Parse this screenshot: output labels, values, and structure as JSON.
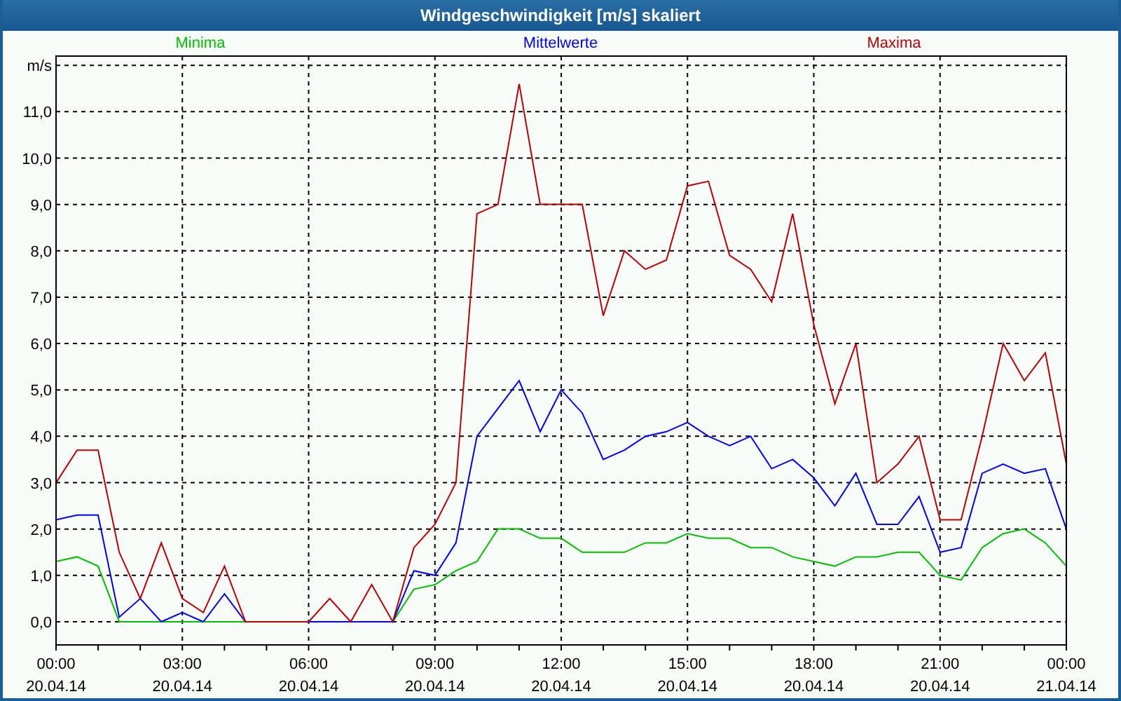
{
  "window": {
    "title": "Windgeschwindigkeit [m/s] skaliert"
  },
  "chart": {
    "chart_data": {
      "type": "line",
      "ylabel": "m/s",
      "grid": true,
      "categories": [
        "00:00 20.04.14",
        null,
        null,
        null,
        null,
        null,
        "03:00 20.04.14",
        null,
        null,
        null,
        null,
        null,
        "06:00 20.04.14",
        null,
        null,
        null,
        null,
        null,
        "09:00 20.04.14",
        null,
        null,
        null,
        null,
        null,
        "12:00 20.04.14",
        null,
        null,
        null,
        null,
        null,
        "15:00 20.04.14",
        null,
        null,
        null,
        null,
        null,
        "18:00 20.04.14",
        null,
        null,
        null,
        null,
        null,
        "21:00 20.04.14",
        null,
        null,
        null,
        null,
        null,
        "00:00 21.04.14"
      ],
      "series": [
        {
          "name": "Minima",
          "color": "#00c000",
          "values": [
            1.3,
            1.4,
            1.2,
            0,
            0,
            0,
            0,
            0,
            0,
            0,
            0,
            0,
            0,
            0,
            0,
            0,
            0,
            0.7,
            0.8,
            1.1,
            1.3,
            2.0,
            2.0,
            1.8,
            1.8,
            1.5,
            1.5,
            1.5,
            1.7,
            1.7,
            1.9,
            1.8,
            1.8,
            1.6,
            1.6,
            1.4,
            1.3,
            1.2,
            1.4,
            1.4,
            1.5,
            1.5,
            1.0,
            0.9,
            1.6,
            1.9,
            2.0,
            1.7,
            1.2
          ]
        },
        {
          "name": "Mittelwerte",
          "color": "#0000ff",
          "values": [
            2.2,
            2.3,
            2.3,
            0.1,
            0.5,
            0,
            0.2,
            0,
            0.6,
            0,
            0,
            0,
            0,
            0,
            0,
            0,
            0,
            1.1,
            1.0,
            1.7,
            4.0,
            4.6,
            5.2,
            4.1,
            5.0,
            4.5,
            3.5,
            3.7,
            4.0,
            4.1,
            4.3,
            4.0,
            3.8,
            4.0,
            3.3,
            3.5,
            3.1,
            2.5,
            3.2,
            2.1,
            2.1,
            2.7,
            1.5,
            1.6,
            3.2,
            3.4,
            3.2,
            3.3,
            2.0
          ]
        },
        {
          "name": "Maxima",
          "color": "#c00000",
          "values": [
            3.0,
            3.7,
            3.7,
            1.5,
            0.5,
            1.7,
            0.5,
            0.2,
            1.2,
            0,
            0,
            0,
            0,
            0.5,
            0,
            0.8,
            0,
            1.6,
            2.1,
            3.0,
            8.8,
            9.0,
            11.6,
            9.0,
            9.0,
            9.0,
            6.6,
            8.0,
            7.6,
            7.8,
            9.4,
            9.5,
            7.9,
            7.6,
            6.9,
            8.8,
            6.4,
            4.7,
            6.0,
            3.0,
            3.4,
            4.0,
            2.2,
            2.2,
            4.0,
            6.0,
            5.2,
            5.8,
            3.4
          ]
        }
      ],
      "ylim": [
        -0.5,
        12.2
      ],
      "yticks": [
        {
          "value": 0,
          "label": "0,0"
        },
        {
          "value": 1,
          "label": "1,0"
        },
        {
          "value": 2,
          "label": "2,0"
        },
        {
          "value": 3,
          "label": "3,0"
        },
        {
          "value": 4,
          "label": "4,0"
        },
        {
          "value": 5,
          "label": "5,0"
        },
        {
          "value": 6,
          "label": "6,0"
        },
        {
          "value": 7,
          "label": "7,0"
        },
        {
          "value": 8,
          "label": "8,0"
        },
        {
          "value": 9,
          "label": "9,0"
        },
        {
          "value": 10,
          "label": "10,0"
        },
        {
          "value": 11,
          "label": "11,0"
        }
      ]
    }
  }
}
